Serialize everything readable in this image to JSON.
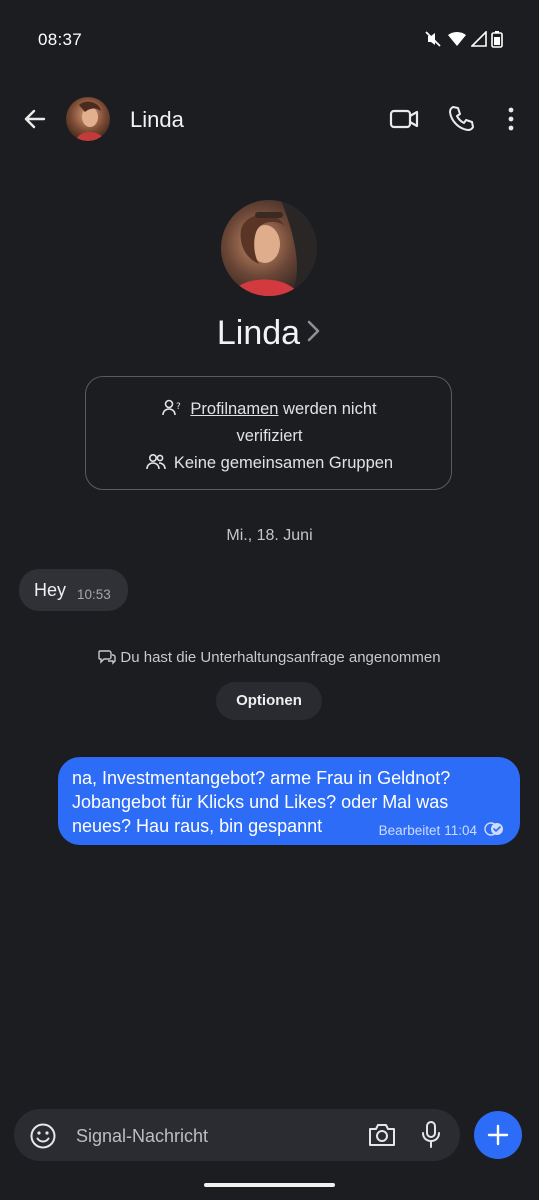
{
  "status_bar": {
    "time": "08:37"
  },
  "header": {
    "contact_name": "Linda"
  },
  "profile": {
    "name": "Linda",
    "profile_names_link": "Profilnamen",
    "profile_names_rest": "werden nicht",
    "profile_names_rest2": "verifiziert",
    "groups_text": "Keine gemeinsamen Gruppen"
  },
  "date_divider": "Mi., 18. Juni",
  "messages": [
    {
      "direction": "incoming",
      "text": "Hey",
      "time": "10:53"
    },
    {
      "direction": "outgoing",
      "text": "na, Investmentangebot? arme Frau in Geldnot? Jobangebot für Klicks und Likes? oder Mal was neues? Hau raus, bin gespannt",
      "edited_label": "Bearbeitet",
      "time": "11:04",
      "status": "read"
    }
  ],
  "system_message": "Du hast die Unterhaltungsanfrage angenommen",
  "options_button": "Optionen",
  "composer": {
    "placeholder": "Signal-Nachricht"
  },
  "colors": {
    "accent": "#2d6cf6",
    "background": "#1c1d21",
    "incoming_bubble": "#303136"
  },
  "icons": [
    "back-arrow-icon",
    "video-call-icon",
    "phone-icon",
    "more-icon",
    "profile-question-icon",
    "group-icon",
    "chat-request-icon",
    "read-receipt-icon",
    "emoji-icon",
    "camera-icon",
    "mic-icon",
    "plus-icon",
    "mute-icon",
    "wifi-icon",
    "signal-icon",
    "battery-icon",
    "chevron-right-icon"
  ]
}
